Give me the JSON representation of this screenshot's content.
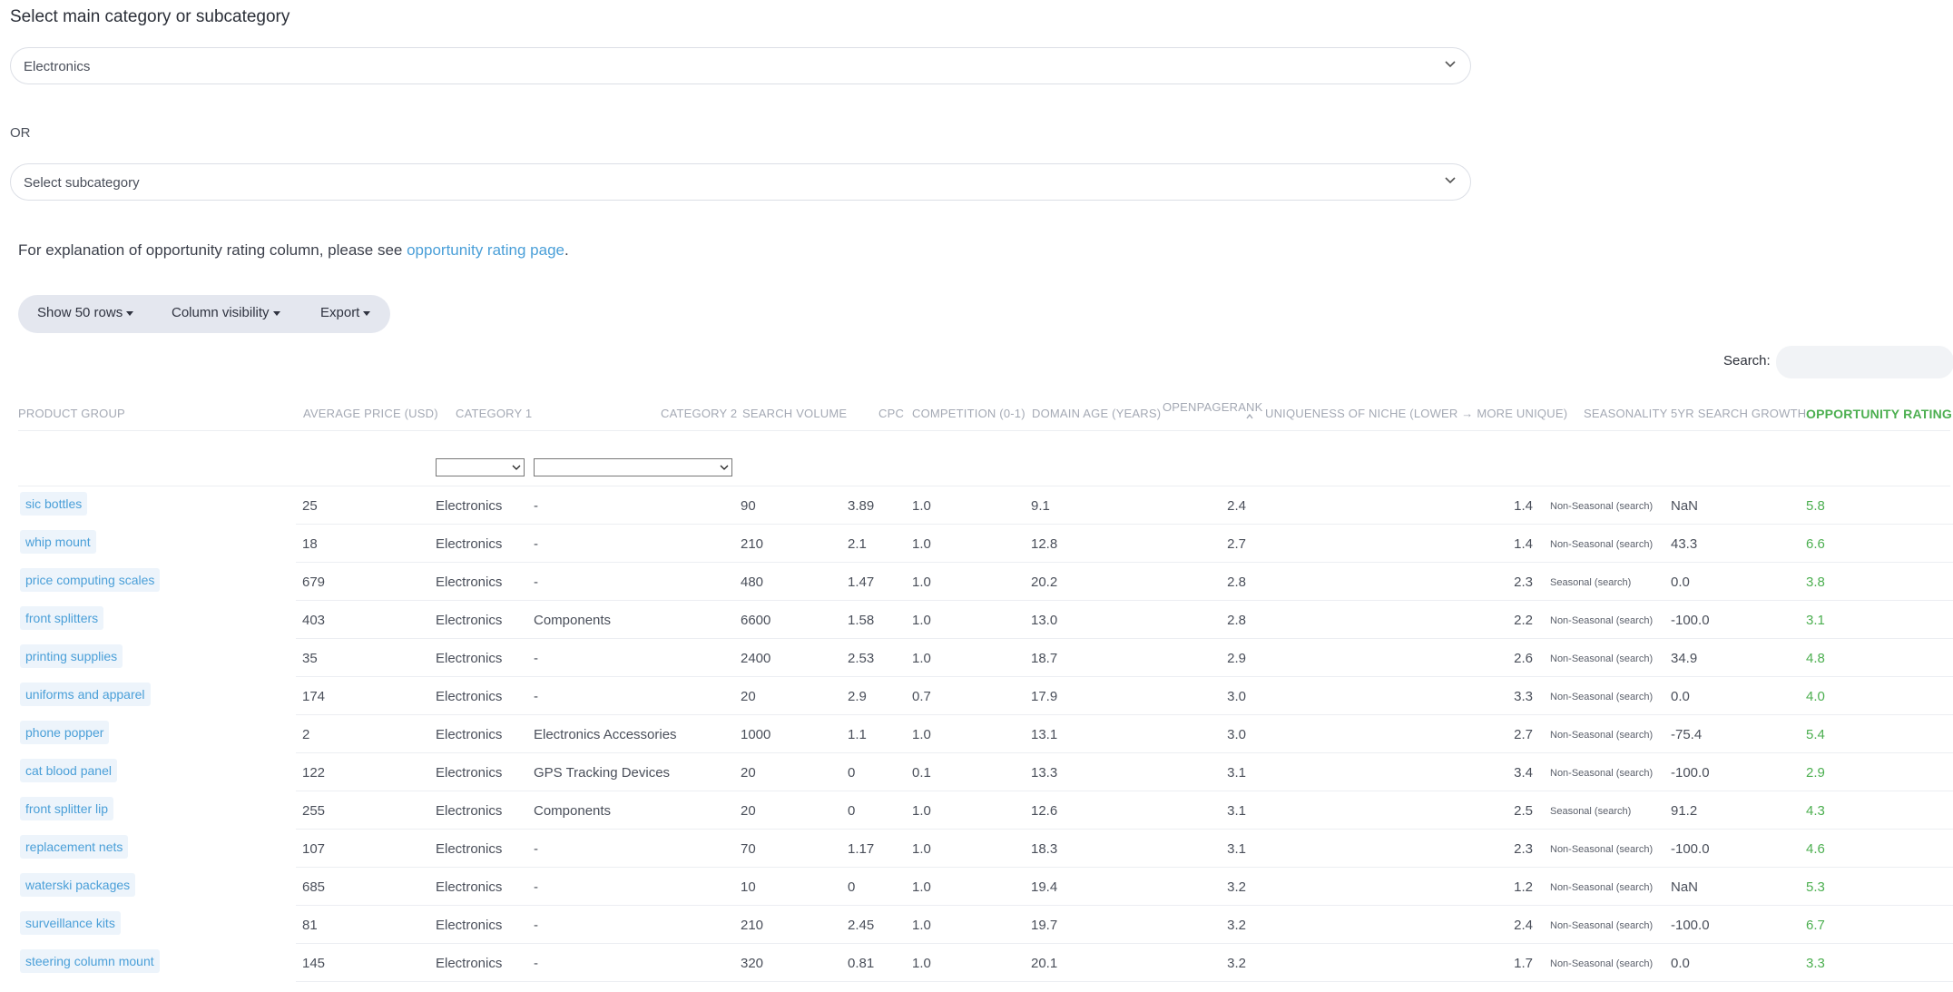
{
  "heading": "Select main category or subcategory",
  "main_category_select": {
    "value": "Electronics"
  },
  "or_label": "OR",
  "subcategory_select": {
    "value": "Select subcategory"
  },
  "explanation": {
    "text": "For explanation of opportunity rating column, please see ",
    "link_text": "opportunity rating page",
    "suffix": "."
  },
  "toolbar": {
    "show_rows": "Show 50 rows",
    "column_visibility": "Column visibility",
    "export": "Export"
  },
  "search": {
    "label": "Search:",
    "value": ""
  },
  "sort": {
    "column": "OpenPageRank",
    "direction": "ascending"
  },
  "colors": {
    "link": "#4a9fd8",
    "rating": "#4caf50",
    "pill_bg": "#edf4fb"
  },
  "table": {
    "headers": {
      "product_group": "PRODUCT GROUP",
      "average_price": "AVERAGE PRICE (USD)",
      "category1": "CATEGORY 1",
      "category2": "CATEGORY 2",
      "search_volume": "SEARCH VOLUME",
      "cpc": "CPC",
      "competition": "COMPETITION (0-1)",
      "domain_age": "DOMAIN AGE (YEARS)",
      "openpagerank": "OPENPAGERANK",
      "uniqueness": "UNIQUENESS OF NICHE (LOWER → MORE UNIQUE)",
      "seasonality": "SEASONALITY",
      "growth": "5YR SEARCH GROWTH",
      "rating": "OPPORTUNITY RATING"
    },
    "rows": [
      {
        "product": "sic bottles",
        "price": "25",
        "cat1": "Electronics",
        "cat2": "-",
        "volume": "90",
        "cpc": "3.89",
        "competition": "1.0",
        "age": "9.1",
        "opr": "2.4",
        "uniq": "1.4",
        "season": "Non-Seasonal (search)",
        "growth": "NaN",
        "rating": "5.8"
      },
      {
        "product": "whip mount",
        "price": "18",
        "cat1": "Electronics",
        "cat2": "-",
        "volume": "210",
        "cpc": "2.1",
        "competition": "1.0",
        "age": "12.8",
        "opr": "2.7",
        "uniq": "1.4",
        "season": "Non-Seasonal (search)",
        "growth": "43.3",
        "rating": "6.6"
      },
      {
        "product": "price computing scales",
        "price": "679",
        "cat1": "Electronics",
        "cat2": "-",
        "volume": "480",
        "cpc": "1.47",
        "competition": "1.0",
        "age": "20.2",
        "opr": "2.8",
        "uniq": "2.3",
        "season": "Seasonal (search)",
        "growth": "0.0",
        "rating": "3.8"
      },
      {
        "product": "front splitters",
        "price": "403",
        "cat1": "Electronics",
        "cat2": "Components",
        "volume": "6600",
        "cpc": "1.58",
        "competition": "1.0",
        "age": "13.0",
        "opr": "2.8",
        "uniq": "2.2",
        "season": "Non-Seasonal (search)",
        "growth": "-100.0",
        "rating": "3.1"
      },
      {
        "product": "printing supplies",
        "price": "35",
        "cat1": "Electronics",
        "cat2": "-",
        "volume": "2400",
        "cpc": "2.53",
        "competition": "1.0",
        "age": "18.7",
        "opr": "2.9",
        "uniq": "2.6",
        "season": "Non-Seasonal (search)",
        "growth": "34.9",
        "rating": "4.8"
      },
      {
        "product": "uniforms and apparel",
        "price": "174",
        "cat1": "Electronics",
        "cat2": "-",
        "volume": "20",
        "cpc": "2.9",
        "competition": "0.7",
        "age": "17.9",
        "opr": "3.0",
        "uniq": "3.3",
        "season": "Non-Seasonal (search)",
        "growth": "0.0",
        "rating": "4.0"
      },
      {
        "product": "phone popper",
        "price": "2",
        "cat1": "Electronics",
        "cat2": "Electronics Accessories",
        "volume": "1000",
        "cpc": "1.1",
        "competition": "1.0",
        "age": "13.1",
        "opr": "3.0",
        "uniq": "2.7",
        "season": "Non-Seasonal (search)",
        "growth": "-75.4",
        "rating": "5.4"
      },
      {
        "product": "cat blood panel",
        "price": "122",
        "cat1": "Electronics",
        "cat2": "GPS Tracking Devices",
        "volume": "20",
        "cpc": "0",
        "competition": "0.1",
        "age": "13.3",
        "opr": "3.1",
        "uniq": "3.4",
        "season": "Non-Seasonal (search)",
        "growth": "-100.0",
        "rating": "2.9"
      },
      {
        "product": "front splitter lip",
        "price": "255",
        "cat1": "Electronics",
        "cat2": "Components",
        "volume": "20",
        "cpc": "0",
        "competition": "1.0",
        "age": "12.6",
        "opr": "3.1",
        "uniq": "2.5",
        "season": "Seasonal (search)",
        "growth": "91.2",
        "rating": "4.3"
      },
      {
        "product": "replacement nets",
        "price": "107",
        "cat1": "Electronics",
        "cat2": "-",
        "volume": "70",
        "cpc": "1.17",
        "competition": "1.0",
        "age": "18.3",
        "opr": "3.1",
        "uniq": "2.3",
        "season": "Non-Seasonal (search)",
        "growth": "-100.0",
        "rating": "4.6"
      },
      {
        "product": "waterski packages",
        "price": "685",
        "cat1": "Electronics",
        "cat2": "-",
        "volume": "10",
        "cpc": "0",
        "competition": "1.0",
        "age": "19.4",
        "opr": "3.2",
        "uniq": "1.2",
        "season": "Non-Seasonal (search)",
        "growth": "NaN",
        "rating": "5.3"
      },
      {
        "product": "surveillance kits",
        "price": "81",
        "cat1": "Electronics",
        "cat2": "-",
        "volume": "210",
        "cpc": "2.45",
        "competition": "1.0",
        "age": "19.7",
        "opr": "3.2",
        "uniq": "2.4",
        "season": "Non-Seasonal (search)",
        "growth": "-100.0",
        "rating": "6.7"
      },
      {
        "product": "steering column mount",
        "price": "145",
        "cat1": "Electronics",
        "cat2": "-",
        "volume": "320",
        "cpc": "0.81",
        "competition": "1.0",
        "age": "20.1",
        "opr": "3.2",
        "uniq": "1.7",
        "season": "Non-Seasonal (search)",
        "growth": "0.0",
        "rating": "3.3"
      }
    ]
  }
}
